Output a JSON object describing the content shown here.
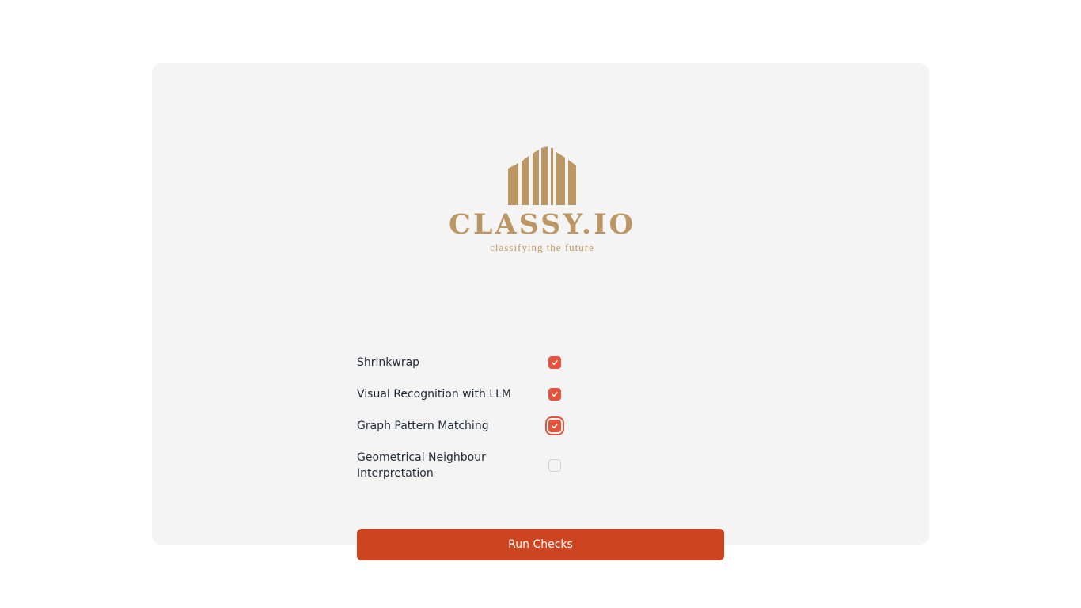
{
  "brand": {
    "name": "CLASSY.IO",
    "tagline": "classifying the future",
    "color": "#bd9763",
    "logo_icon": "buildings-icon"
  },
  "checks": [
    {
      "label": "Shrinkwrap",
      "checked": true
    },
    {
      "label": "Visual Recognition with LLM",
      "checked": true
    },
    {
      "label": "Graph Pattern Matching",
      "checked": true
    },
    {
      "label": "Geometrical Neighbour Interpretation",
      "checked": false
    }
  ],
  "run_button": {
    "label": "Run Checks"
  },
  "colors": {
    "accent": "#e5533d",
    "button": "#cc4420",
    "card_bg": "#f4f4f4"
  }
}
